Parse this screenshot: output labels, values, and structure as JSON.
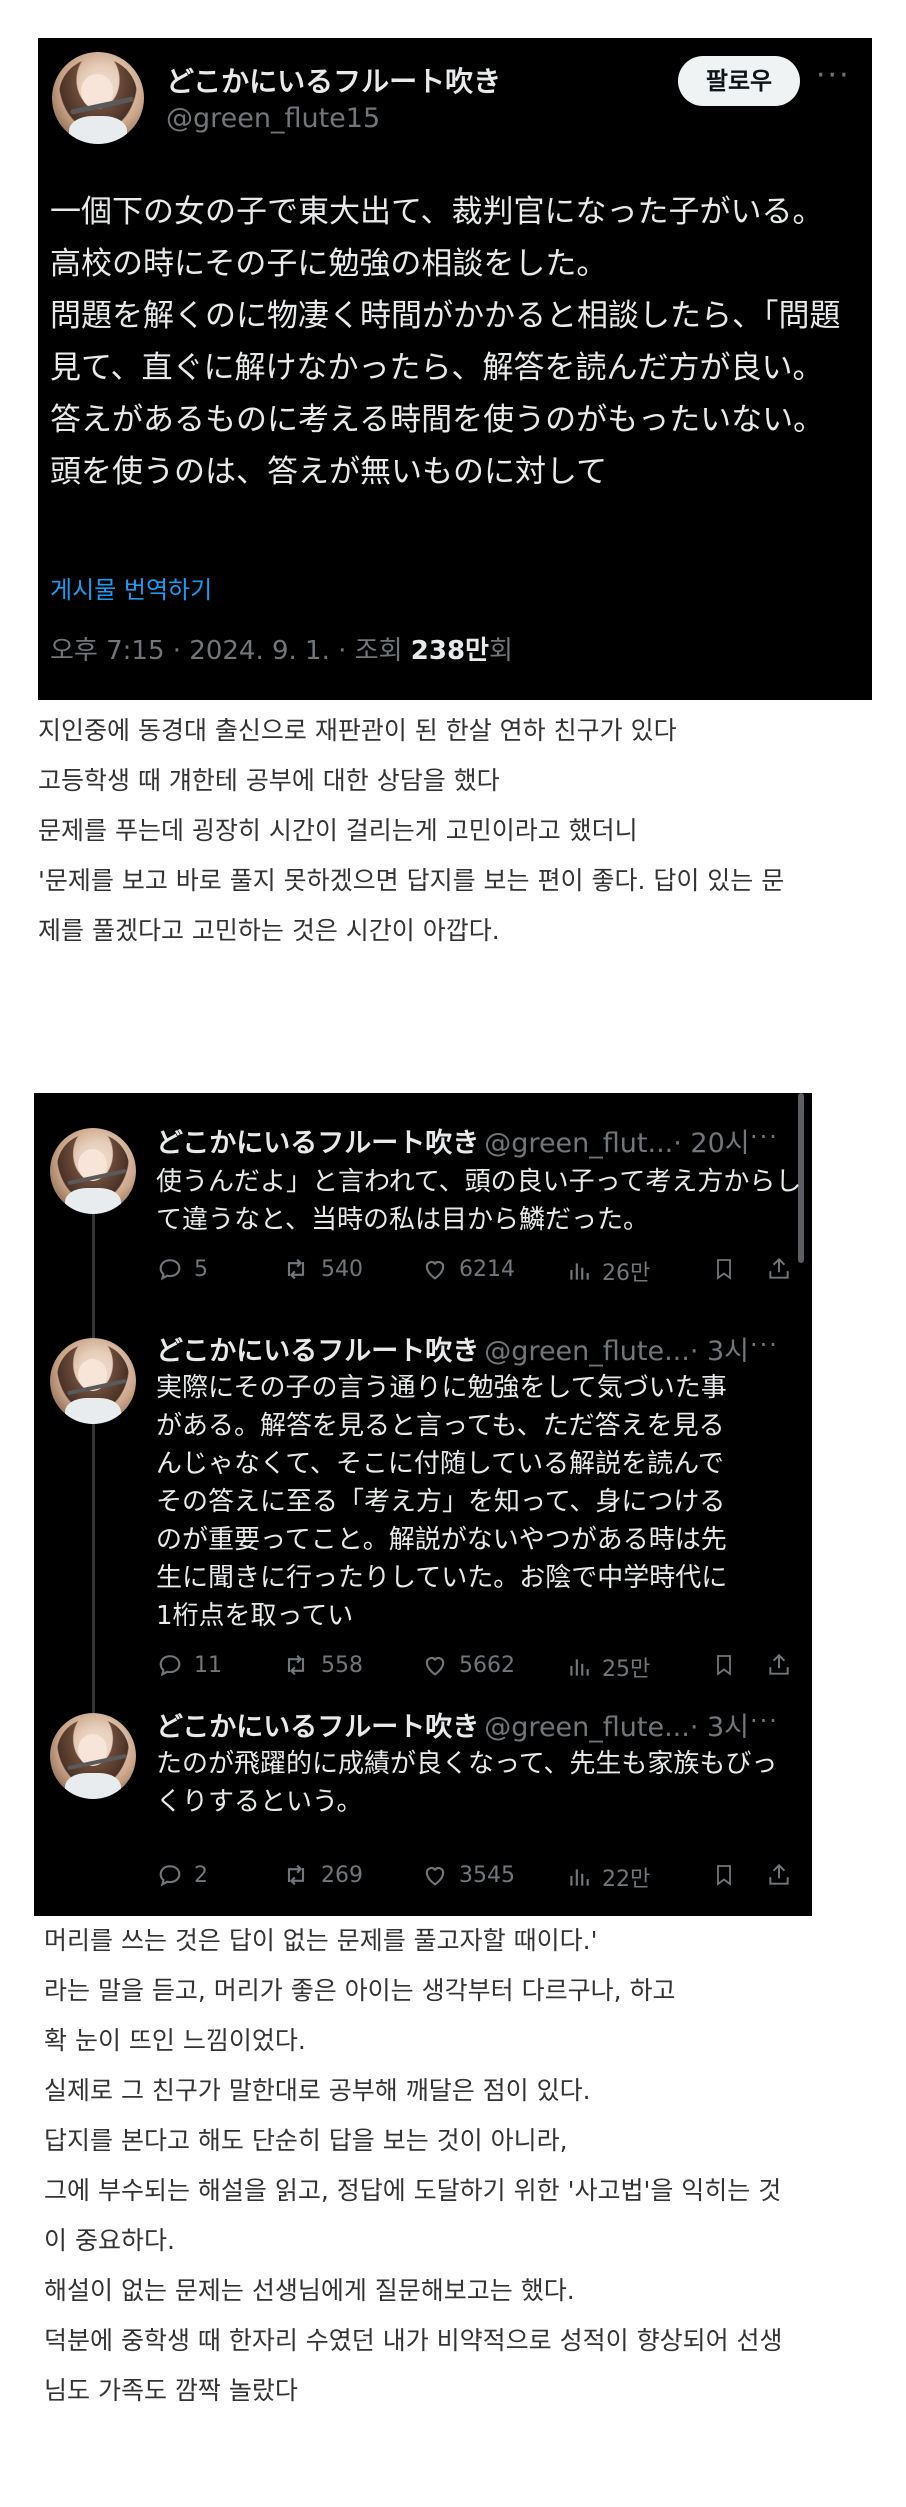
{
  "tweet1": {
    "author_name": "どこかにいるフルート吹き",
    "author_handle": "@green_flute15",
    "follow_label": "팔로우",
    "more_label": "···",
    "body_lines": [
      "一個下の女の子で東大出て、裁判官になった子がいる。",
      "高校の時にその子に勉強の相談をした。",
      "問題を解くのに物凄く時間がかかると相談したら、「問題",
      "見て、直ぐに解けなかったら、解答を読んだ方が良い。",
      "答えがあるものに考える時間を使うのがもったいない。",
      "頭を使うのは、答えが無いものに対して"
    ],
    "translate_label": "게시물 번역하기",
    "meta_prefix": "오후 7:15 · 2024. 9. 1. · 조회 ",
    "meta_views": "238만",
    "meta_suffix": "회"
  },
  "translation1": [
    "지인중에 동경대 출신으로 재판관이 된 한살 연하 친구가 있다",
    "고등학생 때 걔한테 공부에 대한 상담을 했다",
    "문제를 푸는데 굉장히 시간이 걸리는게 고민이라고 했더니",
    "'문제를 보고 바로 풀지 못하겠으면 답지를 보는 편이 좋다. 답이 있는 문",
    "제를 풀겠다고 고민하는 것은 시간이 아깝다."
  ],
  "thread": [
    {
      "name": "どこかにいるフルート吹き",
      "handle": "@green_flut...",
      "time": "· 20시",
      "body_lines": [
        "使うんだよ」と言われて、頭の良い子って考え方からし",
        "て違うなと、当時の私は目から鱗だった。"
      ],
      "replies": "5",
      "reposts": "540",
      "likes": "6214",
      "views": "26만"
    },
    {
      "name": "どこかにいるフルート吹き",
      "handle": "@green_flute...",
      "time": "· 3시",
      "body_lines": [
        "実際にその子の言う通りに勉強をして気づいた事",
        "がある。解答を見ると言っても、ただ答えを見る",
        "んじゃなくて、そこに付随している解説を読んで",
        "その答えに至る「考え方」を知って、身につける",
        "のが重要ってこと。解説がないやつがある時は先",
        "生に聞きに行ったりしていた。お陰で中学時代に",
        "1桁点を取ってい"
      ],
      "replies": "11",
      "reposts": "558",
      "likes": "5662",
      "views": "25만"
    },
    {
      "name": "どこかにいるフルート吹き",
      "handle": "@green_flute...",
      "time": "· 3시",
      "body_lines": [
        "たのが飛躍的に成績が良くなって、先生も家族もびっ",
        "くりするという。"
      ],
      "replies": "2",
      "reposts": "269",
      "likes": "3545",
      "views": "22만"
    }
  ],
  "translation2": [
    "머리를 쓰는 것은 답이 없는 문제를 풀고자할 때이다.'",
    "라는 말을 듣고, 머리가 좋은 아이는 생각부터 다르구나, 하고",
    "확 눈이 뜨인 느낌이었다.",
    "실제로 그 친구가 말한대로 공부해 깨달은 점이 있다.",
    "답지를 본다고 해도 단순히 답을 보는 것이 아니라,",
    "그에 부수되는 해설을 읽고, 정답에 도달하기 위한 '사고법'을 익히는 것",
    "이 중요하다.",
    "해설이 없는 문제는 선생님에게 질문해보고는 했다.",
    "덕분에 중학생 때 한자리 수였던 내가 비약적으로 성적이 향상되어 선생",
    "님도 가족도 깜짝 놀랐다"
  ],
  "icons": {
    "reply": "reply-icon",
    "repost": "repost-icon",
    "like": "heart-icon",
    "views": "views-chart-icon",
    "bookmark": "bookmark-icon",
    "share": "share-icon"
  },
  "colors": {
    "card_bg": "#000000",
    "link_blue": "#1d9bf0",
    "muted_gray": "#71767b",
    "body_text": "#e7e9ea",
    "korean_text": "#333333"
  }
}
